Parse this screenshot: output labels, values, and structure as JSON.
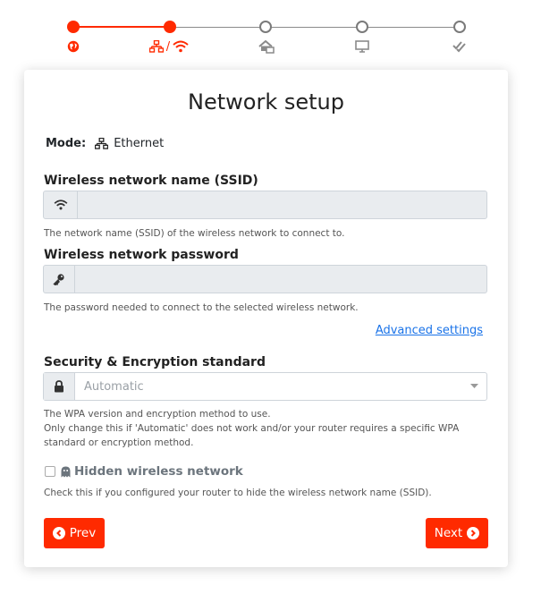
{
  "stepper": {
    "steps": [
      {
        "icon": "globe-icon",
        "state": "done"
      },
      {
        "icon": "network-wifi-icon",
        "state": "active",
        "separator": "/"
      },
      {
        "icon": "home-icon",
        "state": "todo"
      },
      {
        "icon": "monitor-icon",
        "state": "todo"
      },
      {
        "icon": "double-check-icon",
        "state": "todo"
      }
    ],
    "accent": "#ff2a00",
    "inactive": "#7a7a7a"
  },
  "card": {
    "title": "Network setup",
    "mode_label": "Mode:",
    "mode_value": "Ethernet",
    "ssid": {
      "label": "Wireless network name (SSID)",
      "value": "",
      "help": "The network name (SSID) of the wireless network to connect to."
    },
    "password": {
      "label": "Wireless network password",
      "value": "",
      "help": "The password needed to connect to the selected wireless network."
    },
    "advanced_link": "Advanced settings",
    "security": {
      "label": "Security & Encryption standard",
      "selected": "Automatic",
      "help_1": "The WPA version and encryption method to use.",
      "help_2": "Only change this if 'Automatic' does not work and/or your router requires a specific WPA standard or encryption method."
    },
    "hidden": {
      "label": "Hidden wireless network",
      "help": "Check this if you configured your router to hide the wireless network name (SSID).",
      "checked": false
    },
    "prev_label": "Prev",
    "next_label": "Next"
  }
}
